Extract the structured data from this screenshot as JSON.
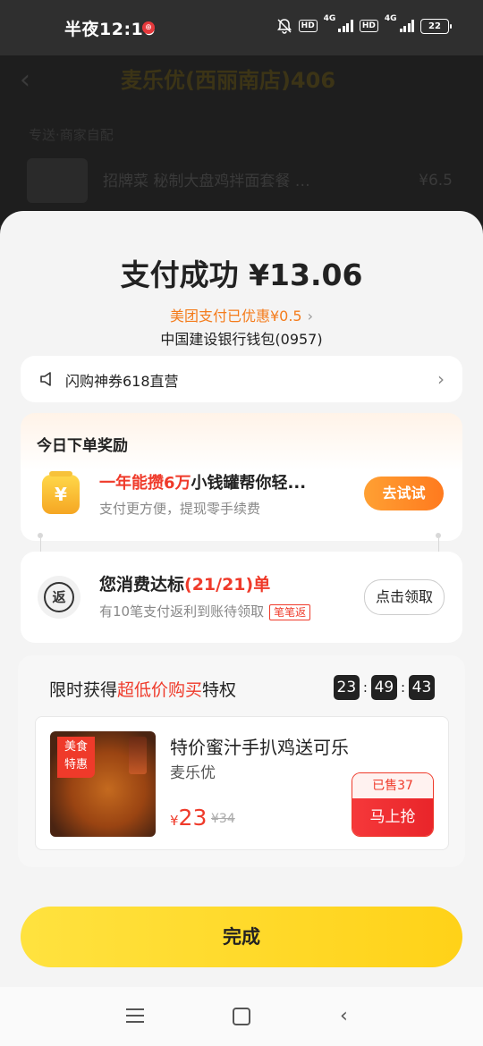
{
  "status_bar": {
    "time": "半夜12:10",
    "badge": "⊕",
    "hd": "HD",
    "net": "4G",
    "battery": "22"
  },
  "background_page": {
    "back": "‹",
    "title": "麦乐优(西丽南店)406",
    "subtitle": "专送·商家自配",
    "item": "招牌菜 秘制大盘鸡拌面套餐 …",
    "price": "¥6.5"
  },
  "payment": {
    "title": "支付成功 ¥13.06",
    "discount": "美团支付已优惠¥0.5",
    "bank": "中国建设银行钱包(0957)"
  },
  "notice": {
    "text": "闪购神券618直营"
  },
  "reward": {
    "heading": "今日下单奖励",
    "line1_highlight": "一年能攒6万",
    "line1_rest": "小钱罐帮你轻...",
    "line2": "支付更方便，提现零手续费",
    "button": "去试试",
    "jar_symbol": "¥"
  },
  "rebate": {
    "icon_text": "返",
    "line1_prefix": "您消费达标",
    "line1_highlight": "(21/21)单",
    "line2": "有10笔支付返利到账待领取",
    "tag": "笔笔返",
    "button": "点击领取"
  },
  "deal": {
    "head_prefix": "限时获得",
    "head_highlight": "超低价购买",
    "head_suffix": "特权",
    "countdown": [
      "23",
      "49",
      "43"
    ],
    "badge_line1": "美食",
    "badge_line2": "特惠",
    "product_name": "特价蜜汁手扒鸡送可乐",
    "shop": "麦乐优",
    "currency": "¥",
    "price": "23",
    "old_price": "¥34",
    "sold": "已售37",
    "buy_button": "马上抢"
  },
  "done_button": "完成",
  "colors": {
    "accent_red": "#ef3a2a",
    "accent_orange": "#f47c1c",
    "button_yellow": "#ffd218"
  }
}
